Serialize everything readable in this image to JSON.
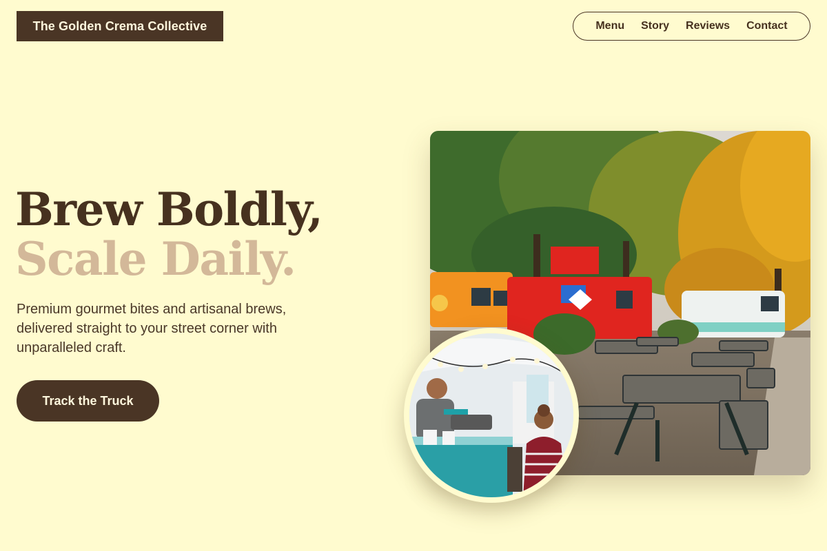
{
  "brand": {
    "name": "The Golden Crema Collective"
  },
  "nav": {
    "items": [
      {
        "label": "Menu"
      },
      {
        "label": "Story"
      },
      {
        "label": "Reviews"
      },
      {
        "label": "Contact"
      }
    ]
  },
  "hero": {
    "headline_line1": "Brew Boldly,",
    "headline_line2": "Scale Daily.",
    "lede": "Premium gourmet bites and artisanal brews, delivered straight to your street corner with unparalleled craft.",
    "cta_label": "Track the Truck"
  },
  "images": {
    "main": "food-trucks-park-photo",
    "inset": "food-truck-vendor-photo"
  },
  "colors": {
    "background": "#fffbcf",
    "brand_dark": "#4a3525",
    "accent_tan": "#d3b899"
  }
}
